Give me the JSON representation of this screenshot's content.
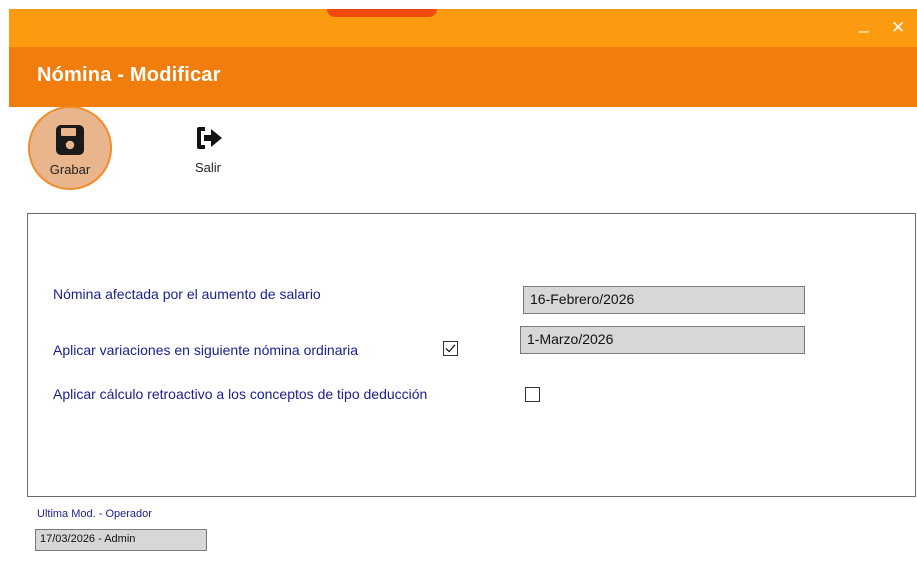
{
  "window": {
    "minimize_glyph": "_",
    "close_glyph": "✕",
    "accent_color": "#f07d0c"
  },
  "header": {
    "title": "Nómina - Modificar"
  },
  "toolbar": {
    "save_label": "Grabar",
    "save_icon": "floppy-disk-icon",
    "exit_label": "Salir",
    "exit_icon": "sign-out-icon"
  },
  "form": {
    "row1_label": "Nómina afectada por el aumento de salario",
    "row1_value": "16-Febrero/2026",
    "row2_label": "Aplicar variaciones en siguiente nómina ordinaria",
    "row2_checked": true,
    "row2_value": "1-Marzo/2026",
    "row3_label": "Aplicar cálculo retroactivo a los conceptos de tipo deducción",
    "row3_checked": false
  },
  "footer": {
    "label": "Ultima Mod. - Operador",
    "value": "17/03/2026 - Admin"
  }
}
